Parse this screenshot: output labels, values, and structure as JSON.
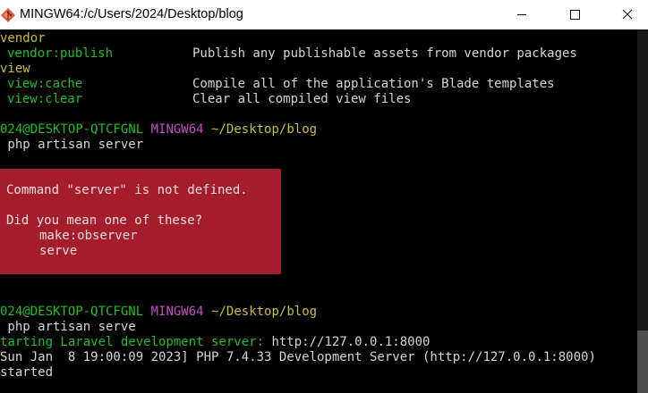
{
  "window": {
    "title": "MINGW64:/c/Users/2024/Desktop/blog"
  },
  "terminal": {
    "commands": [
      {
        "name": "vendor",
        "desc": ""
      },
      {
        "name": "vendor:publish",
        "desc": "Publish any publishable assets from vendor packages"
      },
      {
        "name": "view",
        "desc": ""
      },
      {
        "name": "view:cache",
        "desc": "Compile all of the application's Blade templates"
      },
      {
        "name": "view:clear",
        "desc": "Clear all compiled view files"
      }
    ],
    "prompt1": {
      "user": "024@DESKTOP-QTCFGNL",
      "shell": "MINGW64",
      "path": "~/Desktop/blog"
    },
    "cmd1": " php artisan server",
    "error": {
      "line1": "Command \"server\" is not defined.",
      "line2": "Did you mean one of these?",
      "suggestions": [
        "make:observer",
        "serve"
      ]
    },
    "prompt2": {
      "user": "024@DESKTOP-QTCFGNL",
      "shell": "MINGW64",
      "path": "~/Desktop/blog"
    },
    "cmd2": " php artisan serve",
    "server_msg": "tarting Laravel development server: ",
    "server_url": "http://127.0.0.1:8000",
    "log_line": "Sun Jan  8 19:00:09 2023] PHP 7.4.33 Development Server (http://127.0.0.1:8000)",
    "started": "started"
  },
  "colors": {
    "green": "#1dbf24",
    "magenta": "#c34ec6",
    "yellow": "#c9c02a",
    "error_bg": "#a51d2d"
  },
  "icons": {
    "app": "git-bash-icon",
    "minimize": "minimize-icon",
    "maximize": "maximize-icon",
    "close": "close-icon"
  }
}
